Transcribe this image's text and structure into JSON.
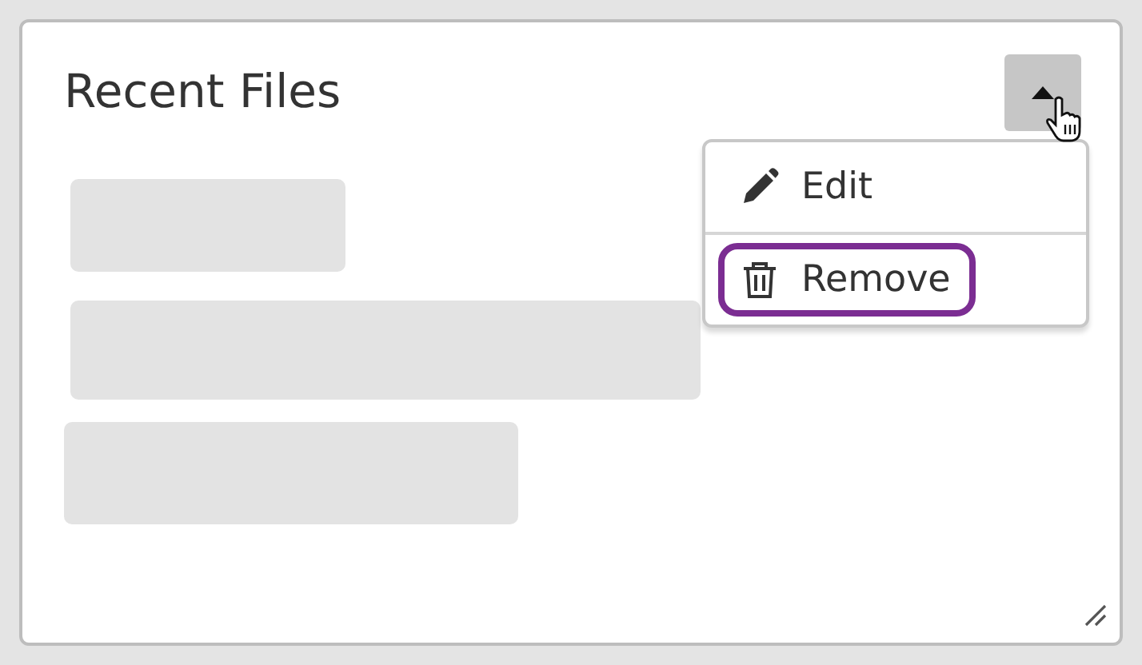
{
  "card": {
    "title": "Recent Files"
  },
  "menu_button": {
    "expanded": true
  },
  "menu": {
    "items": [
      {
        "kind": "edit",
        "label": "Edit",
        "focused": false
      },
      {
        "kind": "remove",
        "label": "Remove",
        "focused": true
      }
    ]
  }
}
